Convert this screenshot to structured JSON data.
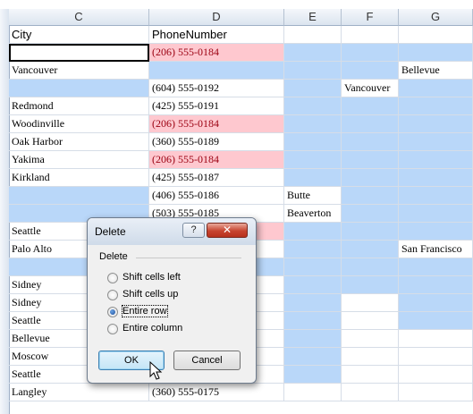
{
  "columns": [
    "C",
    "D",
    "E",
    "F",
    "G"
  ],
  "rows": [
    [
      "City",
      "PhoneNumber",
      "",
      "",
      ""
    ],
    [
      "",
      "(206) 555-0184",
      "",
      "",
      ""
    ],
    [
      "Vancouver",
      "",
      "",
      "",
      "Bellevue"
    ],
    [
      "",
      "(604) 555-0192",
      "",
      "Vancouver",
      ""
    ],
    [
      "Redmond",
      "(425) 555-0191",
      "",
      "",
      ""
    ],
    [
      "Woodinville",
      "(206) 555-0184",
      "",
      "",
      ""
    ],
    [
      "Oak Harbor",
      "(360) 555-0189",
      "",
      "",
      ""
    ],
    [
      "Yakima",
      "(206) 555-0184",
      "",
      "",
      ""
    ],
    [
      "Kirkland",
      "(425) 555-0187",
      "",
      "",
      ""
    ],
    [
      "",
      "(406) 555-0186",
      "Butte",
      "",
      ""
    ],
    [
      "",
      "(503) 555-0185",
      "Beaverton",
      "",
      ""
    ],
    [
      "Seattle",
      "",
      "",
      "",
      ""
    ],
    [
      "Palo Alto",
      "",
      "",
      "",
      "San Francisco"
    ],
    [
      "",
      "",
      "",
      "",
      ""
    ],
    [
      "Sidney",
      "",
      "",
      "",
      ""
    ],
    [
      "Sidney",
      "",
      "",
      "",
      ""
    ],
    [
      "Seattle",
      "",
      "",
      "",
      ""
    ],
    [
      "Bellevue",
      "",
      "",
      "",
      ""
    ],
    [
      "Moscow",
      "",
      "",
      "",
      ""
    ],
    [
      "Seattle",
      "",
      "",
      "",
      ""
    ],
    [
      "Langley",
      "(360) 555-0175",
      "",
      "",
      ""
    ]
  ],
  "colors": {
    "selection": "#b9d7f9",
    "duplicate_fill": "#fec8cf",
    "duplicate_text": "#9b0011"
  },
  "dialog": {
    "title": "Delete",
    "help_label": "?",
    "close_label": "✕",
    "group_label": "Delete",
    "options": [
      {
        "label": "Shift cells left",
        "checked": false
      },
      {
        "label": "Shift cells up",
        "checked": false
      },
      {
        "label": "Entire row",
        "checked": true
      },
      {
        "label": "Entire column",
        "checked": false
      }
    ],
    "ok_label": "OK",
    "cancel_label": "Cancel"
  }
}
